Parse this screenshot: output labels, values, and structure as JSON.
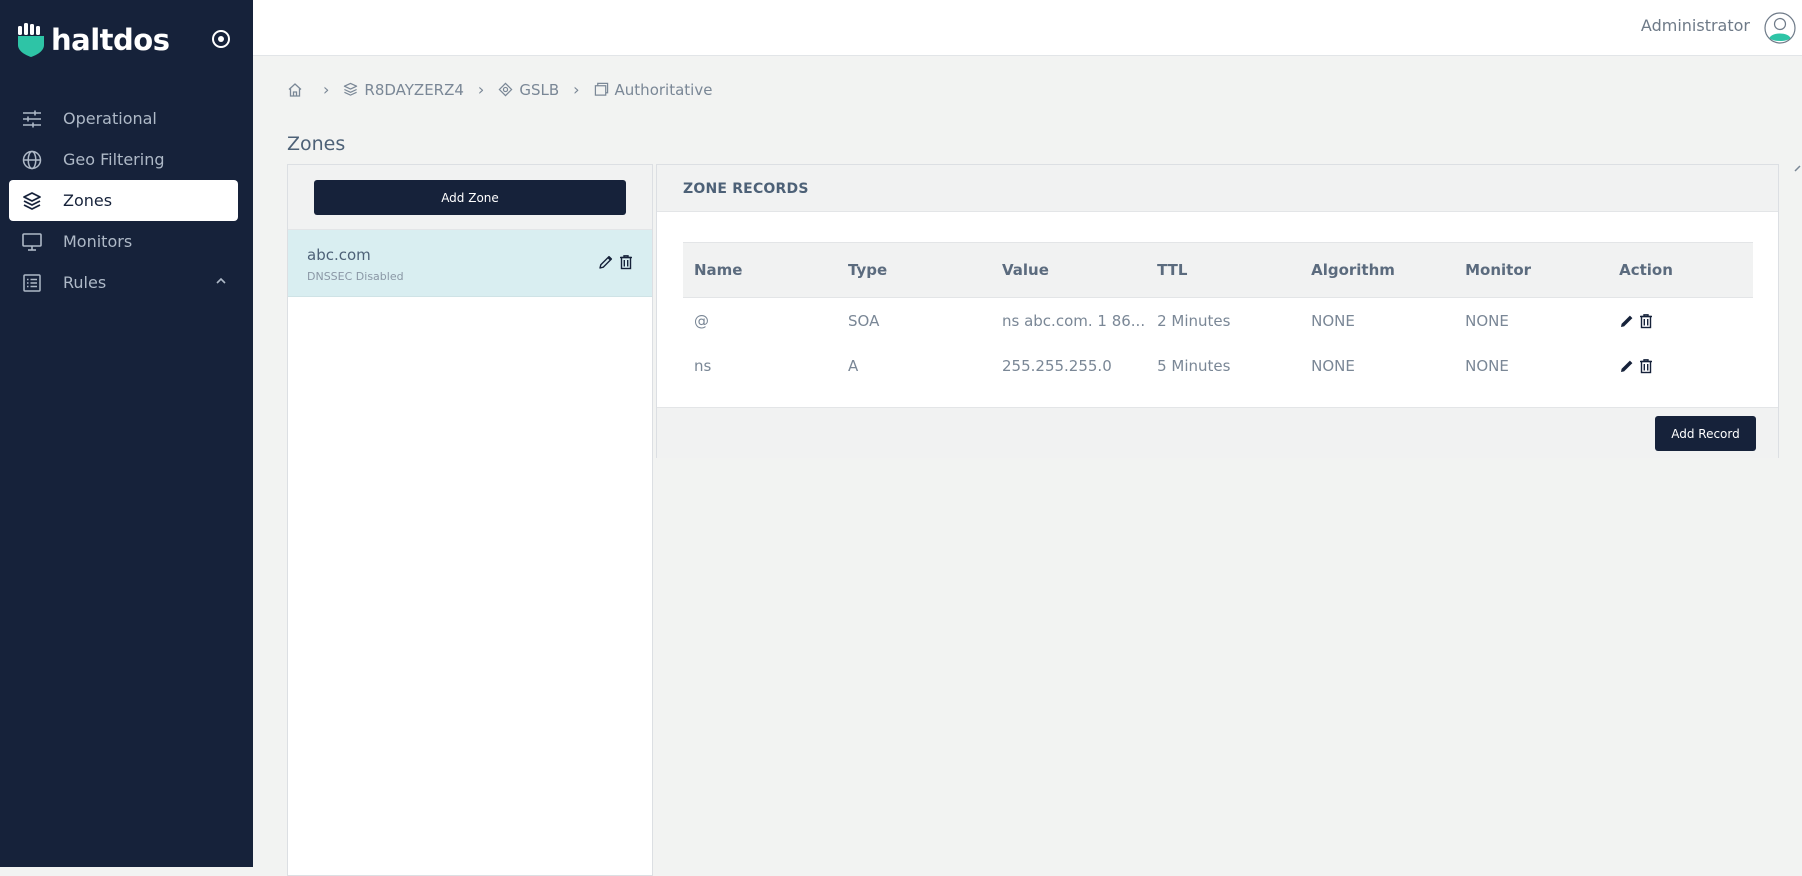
{
  "brand": {
    "name": "haltdos",
    "accent": "#2ec4a6",
    "sidebar_bg": "#16223a"
  },
  "sidebar": {
    "items": [
      {
        "label": "Operational",
        "icon": "sliders-icon",
        "active": false
      },
      {
        "label": "Geo Filtering",
        "icon": "globe-icon",
        "active": false
      },
      {
        "label": "Zones",
        "icon": "layers-icon",
        "active": true
      },
      {
        "label": "Monitors",
        "icon": "monitor-icon",
        "active": false
      },
      {
        "label": "Rules",
        "icon": "list-icon",
        "active": false,
        "expandable": true
      }
    ]
  },
  "topbar": {
    "user": "Administrator"
  },
  "breadcrumb": [
    "R8DAYZERZ4",
    "GSLB",
    "Authoritative"
  ],
  "page_title": "Zones",
  "zones": {
    "add_label": "Add Zone",
    "items": [
      {
        "name": "abc.com",
        "status": "DNSSEC Disabled"
      }
    ]
  },
  "records": {
    "title": "ZONE RECORDS",
    "columns": [
      "Name",
      "Type",
      "Value",
      "TTL",
      "Algorithm",
      "Monitor",
      "Action"
    ],
    "rows": [
      {
        "name": "@",
        "type": "SOA",
        "value": "ns abc.com. 1 86...",
        "ttl": "2 Minutes",
        "algorithm": "NONE",
        "monitor": "NONE"
      },
      {
        "name": "ns",
        "type": "A",
        "value": "255.255.255.0",
        "ttl": "5 Minutes",
        "algorithm": "NONE",
        "monitor": "NONE"
      }
    ],
    "add_label": "Add Record"
  }
}
